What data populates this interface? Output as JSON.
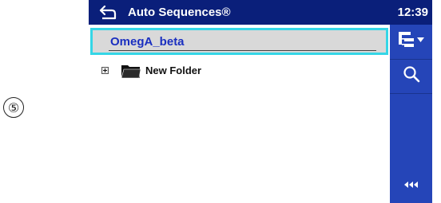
{
  "step_marker": "⑤",
  "header": {
    "title": "Auto Sequences®",
    "clock": "12:39",
    "back_icon": "back-arrow-icon"
  },
  "list": {
    "selected_item": "OmegA_beta",
    "folder_item": "New Folder"
  },
  "toolbar": {
    "tree_icon": "tree-menu-icon",
    "search_icon": "search-icon",
    "more_icon": "more-options-icon"
  },
  "colors": {
    "titlebar": "#0a1f7a",
    "toolbar": "#2545b8",
    "selection_border": "#35d6e6",
    "selection_fill": "#d9d9d9",
    "selected_text": "#1a2fc0"
  }
}
